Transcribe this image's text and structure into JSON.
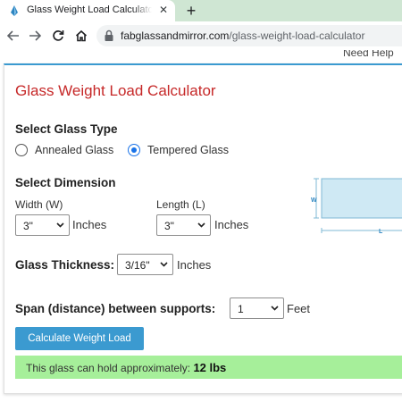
{
  "browser": {
    "tab_title": "Glass Weight Load Calculator - F",
    "new_tab": "+",
    "url_host": "fabglassandmirror.com",
    "url_path": "/glass-weight-load-calculator"
  },
  "header": {
    "need_help": "Need Help"
  },
  "calculator": {
    "title": "Glass Weight Load Calculator",
    "glass_type": {
      "label": "Select Glass Type",
      "options": [
        {
          "label": "Annealed Glass",
          "checked": false
        },
        {
          "label": "Tempered Glass",
          "checked": true
        }
      ]
    },
    "dimension": {
      "label": "Select Dimension",
      "width_label": "Width (W)",
      "width_value": "3\"",
      "length_label": "Length (L)",
      "length_value": "3\"",
      "unit": "Inches",
      "diagram_w": "W",
      "diagram_l": "L"
    },
    "thickness": {
      "label": "Glass Thickness:",
      "value": "3/16\"",
      "unit": "Inches"
    },
    "span": {
      "label": "Span (distance) between supports:",
      "value": "1",
      "unit": "Feet"
    },
    "button_label": "Calculate Weight Load",
    "result_prefix": "This glass can hold approximately:",
    "result_value": "12 lbs"
  },
  "colors": {
    "title": "#c62828",
    "button": "#3b9ad0",
    "result_bg": "#a6ef9a",
    "radio_checked": "#1a73e8"
  }
}
